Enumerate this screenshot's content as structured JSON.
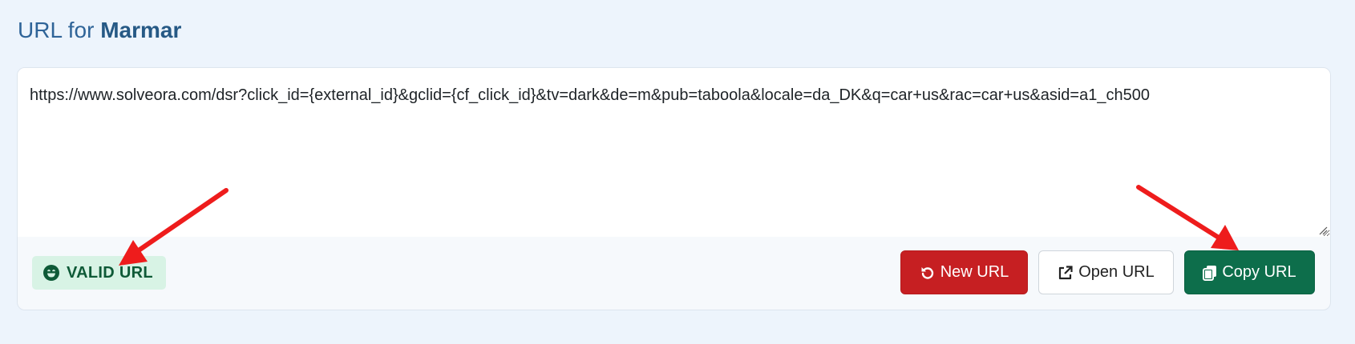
{
  "title": {
    "prefix": "URL for",
    "brand": "Marmar"
  },
  "url_field": {
    "value": "https://www.solveora.com/dsr?click_id={external_id}&gclid={cf_click_id}&tv=dark&de=m&pub=taboola&locale=da_DK&q=car+us&rac=car+us&asid=a1_ch500"
  },
  "status": {
    "label": "VALID URL",
    "icon": "smile-icon",
    "color": "#0e5a37",
    "background": "#d8f3e5"
  },
  "actions": {
    "new_url": {
      "label": "New URL",
      "icon": "undo-icon",
      "color": "#c61f22"
    },
    "open_url": {
      "label": "Open URL",
      "icon": "external-link-icon",
      "color": "#ffffff"
    },
    "copy_url": {
      "label": "Copy URL",
      "icon": "copy-icon",
      "color": "#0d6e4b"
    }
  },
  "annotations": {
    "arrow_color": "#ee1c1c"
  }
}
